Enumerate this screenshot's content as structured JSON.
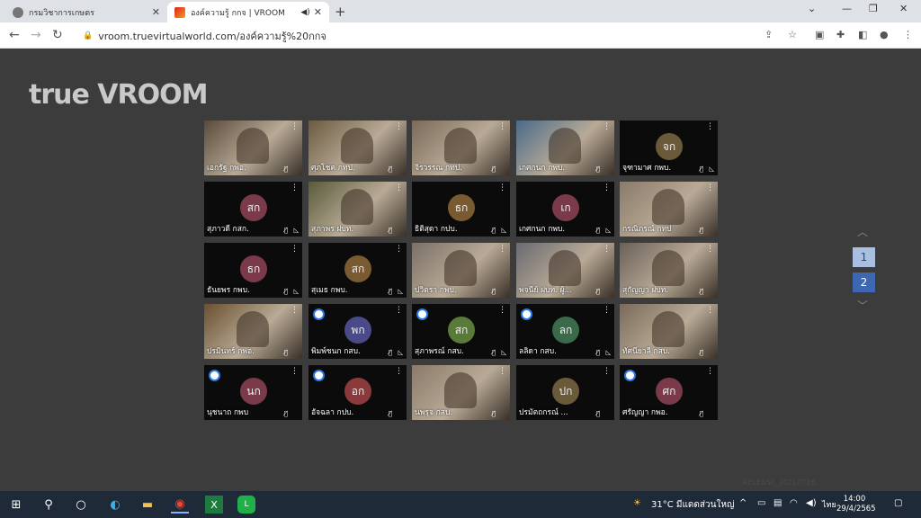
{
  "browser": {
    "tabs": [
      {
        "title": "กรมวิชาการเกษตร",
        "active": false
      },
      {
        "title": "องค์ความรู้ กกจ | VROOM",
        "active": true
      }
    ],
    "new_tab_label": "+",
    "address": "vroom.truevirtualworld.com/องค์ความรู้%20กกจ",
    "window_controls": [
      "⌄",
      "—",
      "❐",
      "✕"
    ]
  },
  "app": {
    "logo": "true VROOM",
    "pages": [
      "1",
      "2"
    ],
    "current_page": "2",
    "watermark": "RELEASE_20210716..."
  },
  "participants": [
    {
      "name": "เอกรัฐ กพอ.",
      "initials": "",
      "video": true,
      "color": "#5a4a3c",
      "mic_off": true,
      "cam_off": false,
      "badge": false
    },
    {
      "name": "ศุภโชค กทป.",
      "initials": "",
      "video": true,
      "color": "#6a5a40",
      "mic_off": true,
      "cam_off": false,
      "badge": false
    },
    {
      "name": "จิรวรรณ กทป.",
      "initials": "",
      "video": true,
      "color": "#7a6a5a",
      "mic_off": true,
      "cam_off": false,
      "badge": false
    },
    {
      "name": "เกศกนก กพบ.",
      "initials": "",
      "video": true,
      "color": "#4a6a8a",
      "mic_off": true,
      "cam_off": false,
      "badge": false
    },
    {
      "name": "จุฑามาศ กพบ.",
      "initials": "จก",
      "video": false,
      "color": "#6b5a3a",
      "mic_off": true,
      "cam_off": true,
      "badge": false
    },
    {
      "name": "สุภาวดี กสก.",
      "initials": "สก",
      "video": false,
      "color": "#7a3a4a",
      "mic_off": true,
      "cam_off": true,
      "badge": false
    },
    {
      "name": "สุภาพร ฝบท.",
      "initials": "",
      "video": true,
      "color": "#5a5a3a",
      "mic_off": true,
      "cam_off": false,
      "badge": false
    },
    {
      "name": "ธิติสุดา กปบ.",
      "initials": "ธก",
      "video": false,
      "color": "#7a5a30",
      "mic_off": true,
      "cam_off": true,
      "badge": false
    },
    {
      "name": "เกศกนก กพบ.",
      "initials": "เก",
      "video": false,
      "color": "#7a3a4a",
      "mic_off": true,
      "cam_off": true,
      "badge": false
    },
    {
      "name": "กรณิภรณ์ กทป",
      "initials": "",
      "video": true,
      "color": "#8a7a6a",
      "mic_off": true,
      "cam_off": false,
      "badge": false
    },
    {
      "name": "ธันยพร กพบ.",
      "initials": "ธก",
      "video": false,
      "color": "#7a3a4a",
      "mic_off": true,
      "cam_off": true,
      "badge": false
    },
    {
      "name": "สุเมธ กพบ.",
      "initials": "สก",
      "video": false,
      "color": "#7a5a30",
      "mic_off": true,
      "cam_off": true,
      "badge": false
    },
    {
      "name": "ปวิตรา กพบ.",
      "initials": "",
      "video": true,
      "color": "#7a7068",
      "mic_off": true,
      "cam_off": false,
      "badge": false
    },
    {
      "name": "พจนีย์ ฝบท. ผู้...",
      "initials": "",
      "video": true,
      "color": "#6a6a70",
      "mic_off": true,
      "cam_off": false,
      "badge": false
    },
    {
      "name": "สุกัญญา ฝบท.",
      "initials": "",
      "video": true,
      "color": "#6a6058",
      "mic_off": true,
      "cam_off": false,
      "badge": false
    },
    {
      "name": "ปรมินทร์ กพอ.",
      "initials": "",
      "video": true,
      "color": "#6a5030",
      "mic_off": true,
      "cam_off": false,
      "badge": false
    },
    {
      "name": "พิมพ์ชนก กสบ.",
      "initials": "พก",
      "video": false,
      "color": "#4a4a8a",
      "mic_off": true,
      "cam_off": true,
      "badge": true
    },
    {
      "name": "สุภาพรณ์ กสบ.",
      "initials": "สก",
      "video": false,
      "color": "#5a7a3a",
      "mic_off": true,
      "cam_off": true,
      "badge": true
    },
    {
      "name": "ลลิดา กสบ.",
      "initials": "ลก",
      "video": false,
      "color": "#3a6a4a",
      "mic_off": true,
      "cam_off": true,
      "badge": true
    },
    {
      "name": "ทัศนียาลี กสบ.",
      "initials": "",
      "video": true,
      "color": "#7a6a5a",
      "mic_off": true,
      "cam_off": false,
      "badge": false
    },
    {
      "name": "นุชนาถ กพบ",
      "initials": "นก",
      "video": false,
      "color": "#7a3a4a",
      "mic_off": true,
      "cam_off": false,
      "badge": true
    },
    {
      "name": "อัจฉลา กปบ.",
      "initials": "อก",
      "video": false,
      "color": "#8a3a3a",
      "mic_off": true,
      "cam_off": false,
      "badge": true
    },
    {
      "name": "นพรุจ กสบ.",
      "initials": "",
      "video": true,
      "color": "#8a7a6a",
      "mic_off": true,
      "cam_off": false,
      "badge": false
    },
    {
      "name": "ปรมัตถกรณ์ ...",
      "initials": "ปก",
      "video": false,
      "color": "#6b5a3a",
      "mic_off": true,
      "cam_off": false,
      "badge": false
    },
    {
      "name": "ศรัญญา กพอ.",
      "initials": "ศก",
      "video": false,
      "color": "#7a3a4a",
      "mic_off": true,
      "cam_off": false,
      "badge": true
    }
  ],
  "taskbar": {
    "weather": "31°C  มีแดดส่วนใหญ่",
    "lang": "ไทย",
    "time": "14:00",
    "date": "29/4/2565"
  }
}
